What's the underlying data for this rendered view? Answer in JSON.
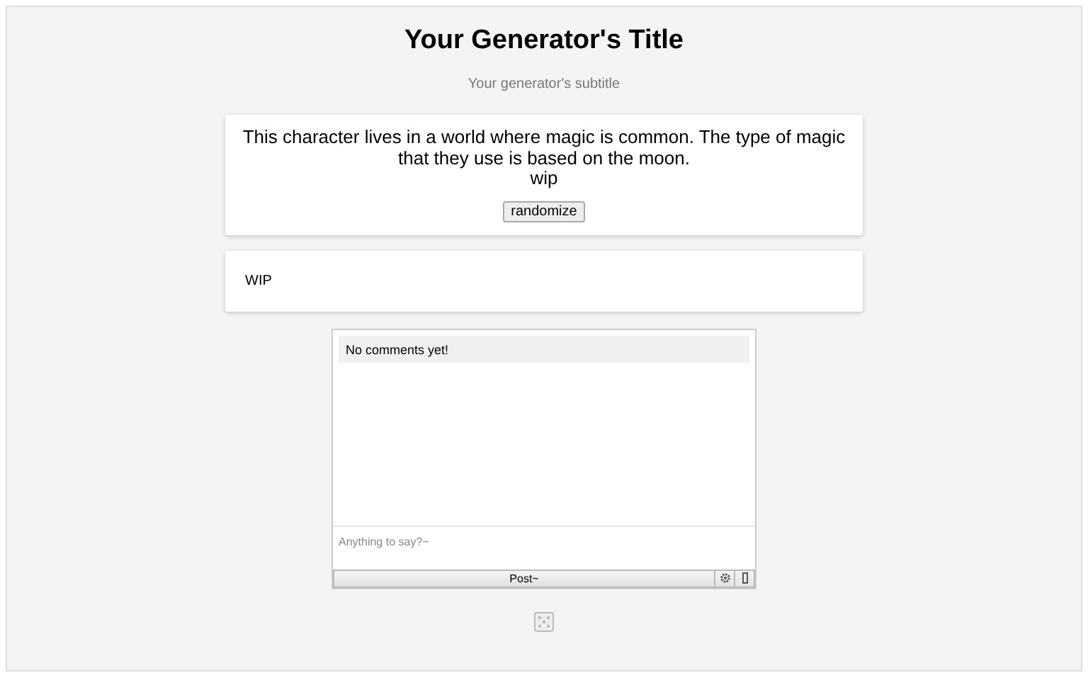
{
  "title": "Your Generator's Title",
  "subtitle": "Your generator's subtitle",
  "output": {
    "lines": [
      "This character lives in a world where magic is common. The type of magic that they use is based on the moon.",
      "wip"
    ],
    "button": "randomize"
  },
  "notes": {
    "text": "WIP"
  },
  "comments": {
    "empty_message": "No comments yet!",
    "placeholder": "Anything to say?~",
    "post_button": "Post~"
  }
}
